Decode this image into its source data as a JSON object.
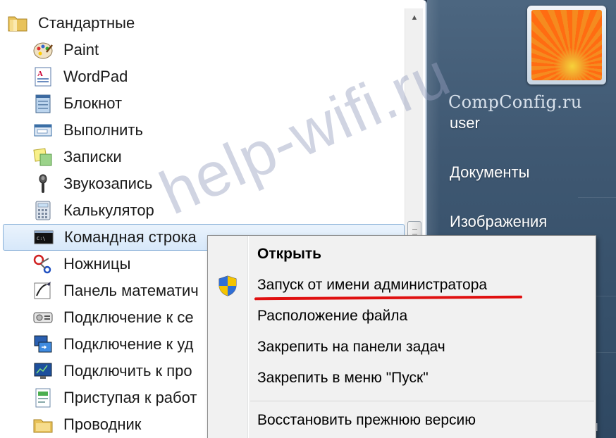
{
  "start_menu": {
    "programs": {
      "folder_label": "Стандартные",
      "items": [
        {
          "label": "Paint",
          "icon": "paint-icon"
        },
        {
          "label": "WordPad",
          "icon": "wordpad-icon"
        },
        {
          "label": "Блокнот",
          "icon": "notepad-icon"
        },
        {
          "label": "Выполнить",
          "icon": "run-icon"
        },
        {
          "label": "Записки",
          "icon": "sticky-notes-icon"
        },
        {
          "label": "Звукозапись",
          "icon": "microphone-icon"
        },
        {
          "label": "Калькулятор",
          "icon": "calculator-icon"
        },
        {
          "label": "Командная строка",
          "icon": "command-prompt-icon"
        },
        {
          "label": "Ножницы",
          "icon": "scissors-icon"
        },
        {
          "label": "Панель математич",
          "icon": "math-panel-icon"
        },
        {
          "label": "Подключение к се",
          "icon": "network-projector-icon"
        },
        {
          "label": "Подключение к уд",
          "icon": "remote-desktop-icon"
        },
        {
          "label": "Подключить к про",
          "icon": "projector-icon"
        },
        {
          "label": "Приступая к работ",
          "icon": "getting-started-icon"
        },
        {
          "label": "Проводник",
          "icon": "explorer-icon"
        }
      ]
    },
    "right_pane": {
      "watermark": "CompConfig.ru",
      "user_name": "user",
      "items": [
        "Документы",
        "Изображения"
      ],
      "cut_text": "я"
    }
  },
  "context_menu": {
    "items": [
      {
        "label": "Открыть"
      },
      {
        "label": "Запуск от имени администратора",
        "icon": "uac-shield-icon"
      },
      {
        "label": "Расположение файла"
      },
      {
        "label": "Закрепить на панели задач"
      },
      {
        "label": "Закрепить в меню \"Пуск\""
      },
      {
        "label": "Восстановить прежнюю версию"
      }
    ]
  },
  "overlay_watermark": "help-wifi.ru",
  "colors": {
    "selection": "#d7e8fa",
    "highlight_underline": "#e01010",
    "right_pane": "#3f5872"
  }
}
